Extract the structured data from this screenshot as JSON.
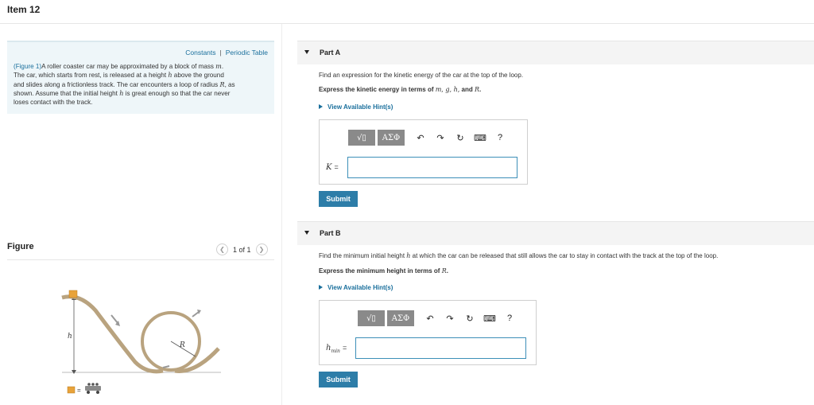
{
  "item": {
    "title": "Item 12"
  },
  "problem": {
    "links": {
      "constants": "Constants",
      "separator": "|",
      "periodic_table": "Periodic Table"
    },
    "figure_ref": "(Figure 1)",
    "line1_a": "A roller coaster car may be approximated by a block of mass ",
    "var_m": "m",
    "line1_b": ".",
    "line2_a": "The car, which starts from rest, is released at a height ",
    "var_h": "h",
    "line2_b": " above the ground",
    "line3_a": "and slides along a frictionless track. The car encounters a loop of radius ",
    "var_R": "R",
    "line3_b": ", as",
    "line4_a": "shown. Assume that the initial height ",
    "var_h2": "h",
    "line4_b": " is great enough so that the car never",
    "line5": "loses contact with the track."
  },
  "figure": {
    "label": "Figure",
    "pager": "1 of 1",
    "prev_icon": "chevron-left-icon",
    "next_icon": "chevron-right-icon",
    "h_label": "h",
    "R_label": "R",
    "legend_eq": "=",
    "colors": {
      "track": "#b9a37f",
      "block": "#e8a33a",
      "arrow": "#999999"
    }
  },
  "partA": {
    "title": "Part A",
    "question": "Find an expression for the kinetic energy of the car at the top of the loop.",
    "instruction_a": "Express the kinetic energy in terms of ",
    "vars": "m, g, h,",
    "instruction_and": " and ",
    "var_last": "R",
    "instruction_end": ".",
    "hint": "View Available Hint(s)",
    "answer_var": "K",
    "answer_eq": "=",
    "answer_value": "",
    "submit": "Submit"
  },
  "partB": {
    "title": "Part B",
    "question_a": "Find the minimum initial height ",
    "var_h": "h",
    "question_b": " at which the car can be released that still allows the car to stay in contact with the track at the top of the loop.",
    "instruction_a": "Express the minimum height in terms of ",
    "var_R": "R",
    "instruction_end": ".",
    "hint": "View Available Hint(s)",
    "answer_var": "h",
    "answer_sub": "min",
    "answer_eq": "=",
    "answer_value": "",
    "submit": "Submit"
  },
  "toolbar": {
    "templates": "√▯",
    "greek": "ΑΣΦ",
    "help": "?",
    "icons": [
      "templates-icon",
      "greek-symbols-icon",
      "undo-icon",
      "redo-icon",
      "reset-icon",
      "keyboard-icon",
      "help-icon"
    ]
  }
}
